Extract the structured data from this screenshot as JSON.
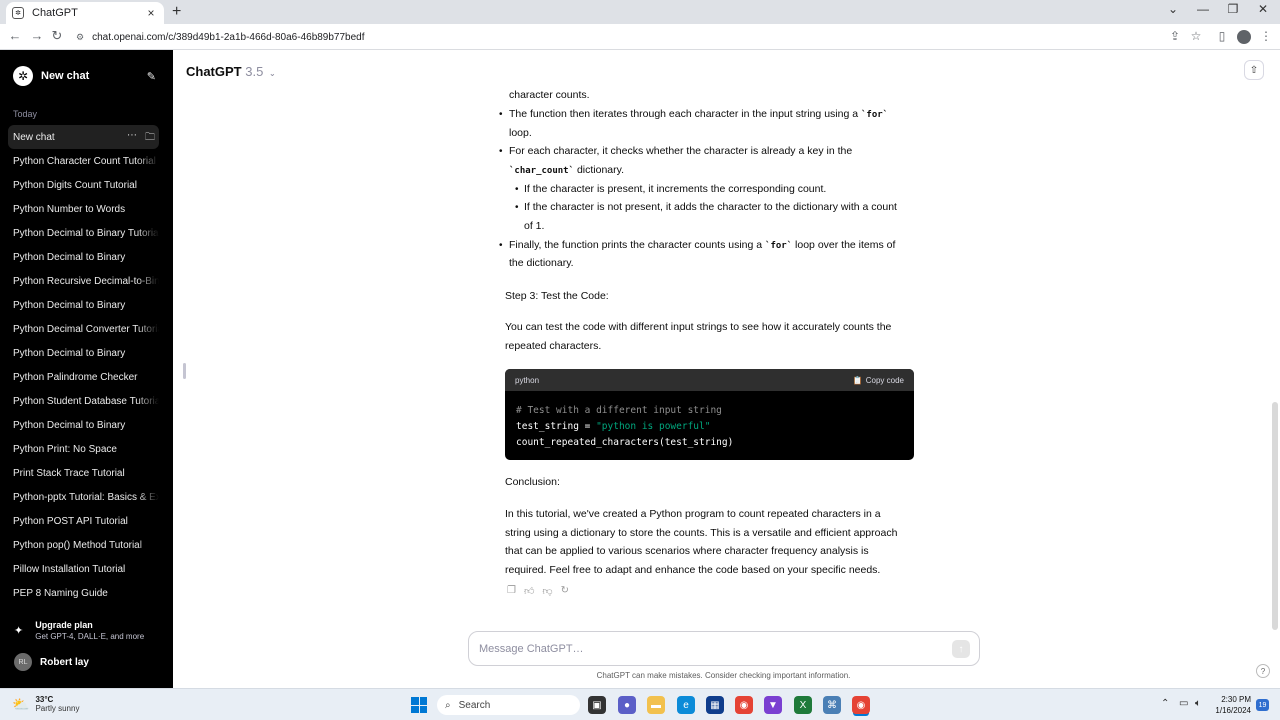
{
  "browser": {
    "tab_title": "ChatGPT",
    "tab_close": "×",
    "new_tab": "+",
    "url": "chat.openai.com/c/389d49b1-2a1b-466d-80a6-46b89b77bedf"
  },
  "sidebar": {
    "new_chat_label": "New chat",
    "section_today": "Today",
    "items": [
      {
        "label": "New chat"
      },
      {
        "label": "Python Character Count Tutorial"
      },
      {
        "label": "Python Digits Count Tutorial"
      },
      {
        "label": "Python Number to Words"
      },
      {
        "label": "Python Decimal to Binary Tutorial"
      },
      {
        "label": "Python Decimal to Binary"
      },
      {
        "label": "Python Recursive Decimal-to-Binary"
      },
      {
        "label": "Python Decimal to Binary"
      },
      {
        "label": "Python Decimal Converter Tutorial"
      },
      {
        "label": "Python Decimal to Binary"
      },
      {
        "label": "Python Palindrome Checker"
      },
      {
        "label": "Python Student Database Tutorial"
      },
      {
        "label": "Python Decimal to Binary"
      },
      {
        "label": "Python Print: No Space"
      },
      {
        "label": "Print Stack Trace Tutorial"
      },
      {
        "label": "Python-pptx Tutorial: Basics & Examples"
      },
      {
        "label": "Python POST API Tutorial"
      },
      {
        "label": "Python pop() Method Tutorial"
      },
      {
        "label": "Pillow Installation Tutorial"
      },
      {
        "label": "PEP 8 Naming Guide"
      }
    ],
    "upgrade_title": "Upgrade plan",
    "upgrade_sub": "Get GPT-4, DALL·E, and more",
    "user_initials": "RL",
    "user_name": "Robert lay"
  },
  "header": {
    "model_name": "ChatGPT",
    "model_version": "3.5"
  },
  "message": {
    "line_char_counts": "character counts.",
    "b1_a": "The function then iterates through each character in the input string using a",
    "b1_code": "`for`",
    "b1_b": "loop.",
    "b2_a": "For each character, it checks whether the character is already a key in the",
    "b2_code": "`char_count`",
    "b2_b": "dictionary.",
    "sb1": "If the character is present, it increments the corresponding count.",
    "sb2_a": "If the character is not present, it adds the character to the dictionary with a count",
    "sb2_b": "of 1.",
    "b3_a": "Finally, the function prints the character counts using a",
    "b3_code": "`for`",
    "b3_b": "loop over the items of",
    "b3_c": "the dictionary.",
    "step3": "Step 3: Test the Code:",
    "test_p1": "You can test the code with different input strings to see how it accurately counts the",
    "test_p2": "repeated characters.",
    "code_lang": "python",
    "copy_label": "Copy code",
    "code_line1": "# Test with a different input string",
    "code_line2_a": "test_string = ",
    "code_line2_b": "\"python is powerful\"",
    "code_line3": "count_repeated_characters(test_string)",
    "conclusion": "Conclusion:",
    "concl_1": "In this tutorial, we've created a Python program to count repeated characters in a",
    "concl_2": "string using a dictionary to store the counts. This is a versatile and efficient approach",
    "concl_3": "that can be applied to various scenarios where character frequency analysis is",
    "concl_4": "required. Feel free to adapt and enhance the code based on your specific needs."
  },
  "composer": {
    "placeholder": "Message ChatGPT…",
    "disclaimer": "ChatGPT can make mistakes. Consider checking important information.",
    "help": "?"
  },
  "taskbar": {
    "temp": "33°C",
    "weather": "Partly sunny",
    "search_label": "Search",
    "time": "2:30 PM",
    "date": "1/16/2024",
    "badge": "19"
  }
}
